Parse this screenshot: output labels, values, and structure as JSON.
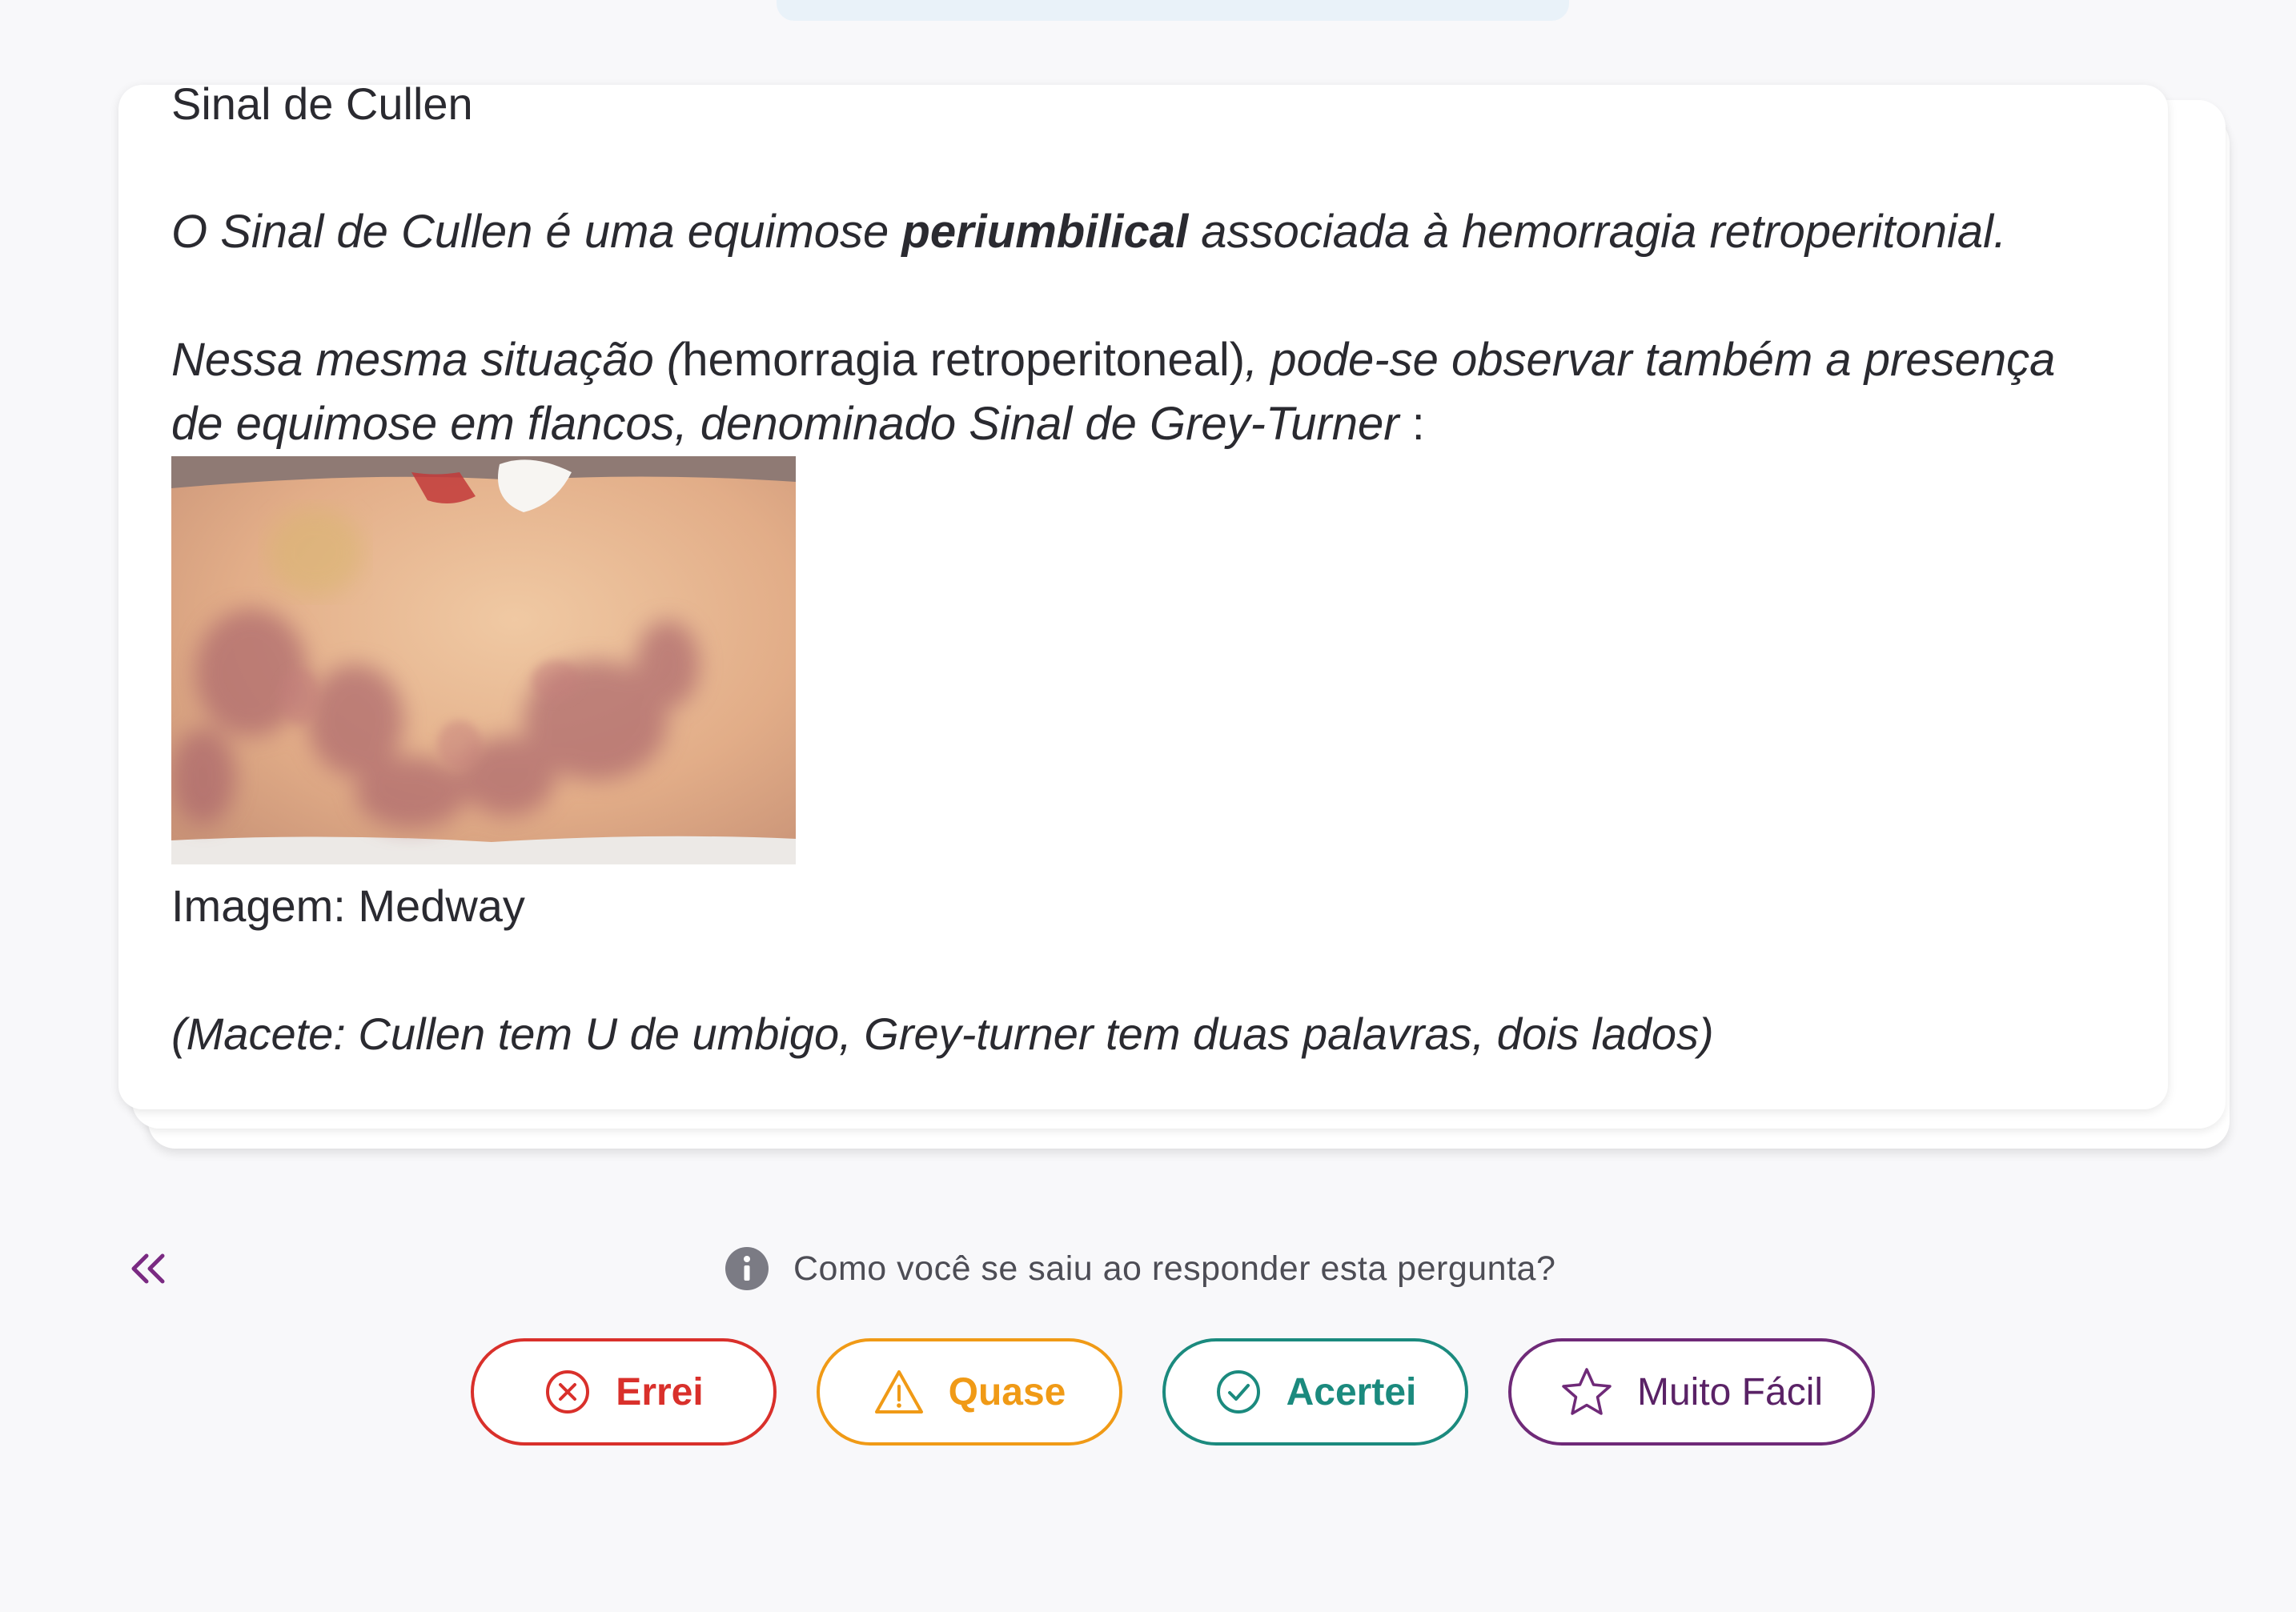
{
  "card": {
    "heading": "Sinal de Cullen",
    "p1_part1": "O Sinal de Cullen é uma equimose ",
    "p1_bold": "periumbilical",
    "p1_part2": " associada à hemorragia retroperitonial.",
    "p2_part1": "Nessa mesma situação (",
    "p2_upright": "hemorragia retroperitoneal)",
    "p2_part2": ", pode-se observar também a presença de equimose em flancos, denominado Sinal de Grey-Turner",
    "p2_colon": " :",
    "image_caption": "Imagem: Medway",
    "macete": "(Macete: Cullen tem U de umbigo, Grey-turner tem duas palavras, dois lados)"
  },
  "feedback": {
    "prompt": "Como você se saiu ao responder esta pergunta?",
    "buttons": {
      "errei": "Errei",
      "quase": "Quase",
      "acertei": "Acertei",
      "muito_facil": "Muito Fácil"
    }
  },
  "icons": {
    "back": "double-chevron-left-icon",
    "info": "info-icon",
    "errei": "x-circle-icon",
    "quase": "warning-triangle-icon",
    "acertei": "check-circle-icon",
    "muito_facil": "star-icon"
  },
  "colors": {
    "errei": "#d9302b",
    "quase": "#f09a16",
    "acertei": "#1b8a7e",
    "muito_facil": "#6f2a78",
    "accent": "#7a2a82"
  }
}
